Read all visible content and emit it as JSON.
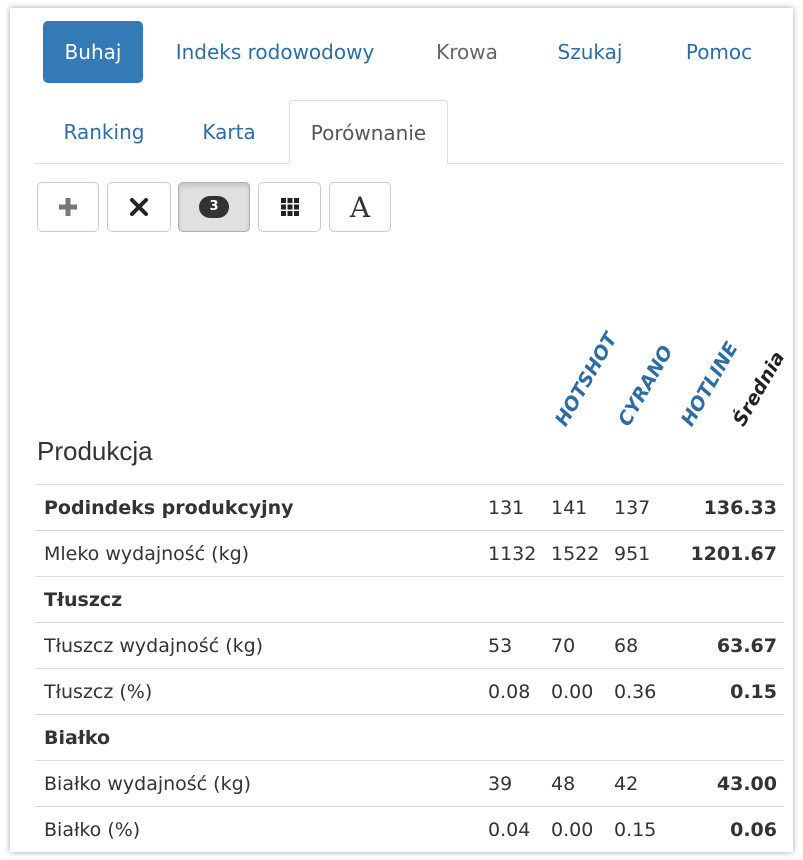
{
  "nav": {
    "items": [
      {
        "label": "Buhaj",
        "active": true
      },
      {
        "label": "Indeks rodowodowy"
      },
      {
        "label": "Krowa"
      },
      {
        "label": "Szukaj"
      },
      {
        "label": "Pomoc"
      }
    ]
  },
  "tabs": {
    "items": [
      {
        "label": "Ranking"
      },
      {
        "label": "Karta"
      },
      {
        "label": "Porównanie",
        "active": true
      }
    ]
  },
  "toolbar": {
    "add_icon": "plus-icon",
    "remove_icon": "close-icon",
    "count_badge": "3",
    "grid_icon": "grid-icon",
    "font_label": "A"
  },
  "columns": {
    "bulls": [
      "HOTSHOT",
      "CYRANO",
      "HOTLINE"
    ],
    "average": "Średnia"
  },
  "section": {
    "title": "Produkcja"
  },
  "rows": [
    {
      "label": "Podindeks produkcyjny",
      "bold": true,
      "values": [
        "131",
        "141",
        "137"
      ],
      "avg": "136.33"
    },
    {
      "label": "Mleko wydajność (kg)",
      "values": [
        "1132",
        "1522",
        "951"
      ],
      "avg": "1201.67"
    },
    {
      "label": "Tłuszcz",
      "bold": true,
      "values": [
        "",
        "",
        ""
      ],
      "avg": ""
    },
    {
      "label": "Tłuszcz wydajność (kg)",
      "values": [
        "53",
        "70",
        "68"
      ],
      "avg": "63.67"
    },
    {
      "label": "Tłuszcz (%)",
      "values": [
        "0.08",
        "0.00",
        "0.36"
      ],
      "avg": "0.15"
    },
    {
      "label": "Białko",
      "bold": true,
      "values": [
        "",
        "",
        ""
      ],
      "avg": ""
    },
    {
      "label": "Białko wydajność (kg)",
      "values": [
        "39",
        "48",
        "42"
      ],
      "avg": "43.00"
    },
    {
      "label": "Białko (%)",
      "values": [
        "0.04",
        "0.00",
        "0.15"
      ],
      "avg": "0.06"
    }
  ],
  "colors": {
    "accent": "#337ab7",
    "link": "#2e6da4"
  }
}
